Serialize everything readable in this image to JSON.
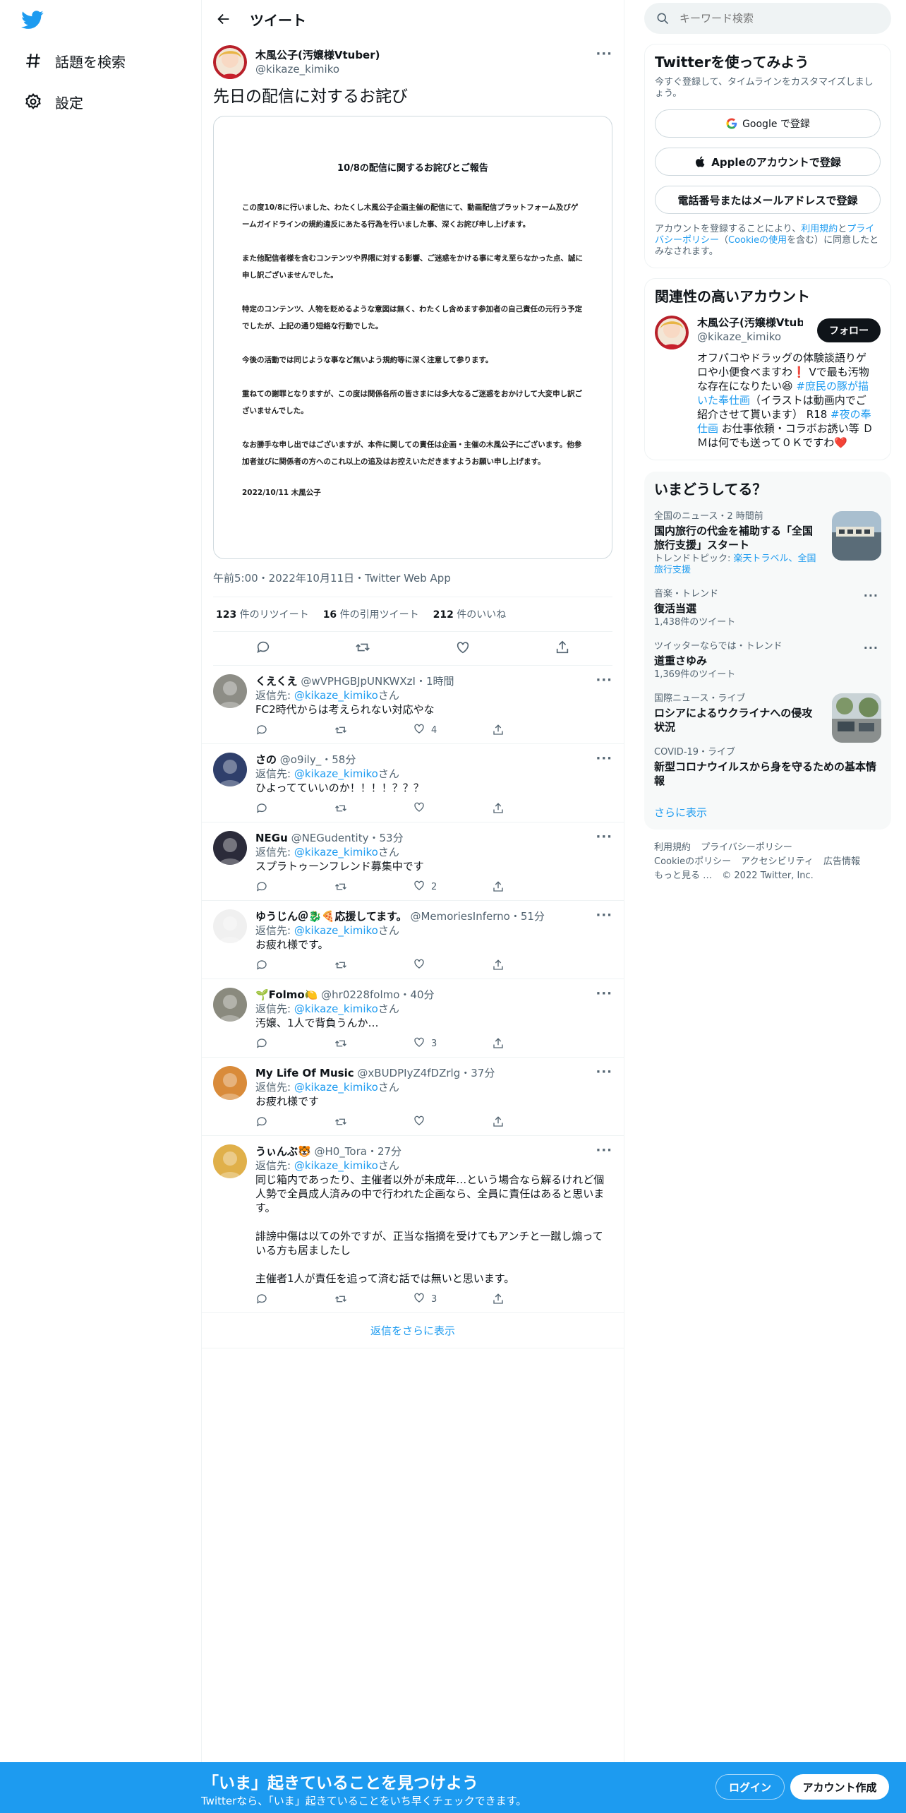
{
  "nav": {
    "explore_label": "話題を検索",
    "settings_label": "設定"
  },
  "header": {
    "title": "ツイート"
  },
  "tweet": {
    "author_name": "木風公子(汚嬢様Vtuber)",
    "author_handle": "@kikaze_kimiko",
    "text": "先日の配信に対するお詫び",
    "document": {
      "title": "10/8の配信に関するお詫びとご報告",
      "paragraphs": [
        "この度10/8に行いました、わたくし木風公子企画主催の配信にて、動画配信プラットフォーム及びゲームガイドラインの規約違反にあたる行為を行いました事、深くお詫び申し上げます。",
        "また他配信者様を含むコンテンツや界隈に対する影響、ご迷惑をかける事に考え至らなかった点、誠に申し訳ございませんでした。",
        "特定のコンテンツ、人物を貶めるような意図は無く、わたくし含めます参加者の自己責任の元行う予定でしたが、上記の通り短絡な行動でした。",
        "今後の活動では同じような事など無いよう規約等に深く注意して参ります。",
        "重ねての謝罪となりますが、この度は関係各所の皆さまには多大なるご迷惑をおかけして大変申し訳ございませんでした。",
        "なお勝手な申し出ではございますが、本件に関しての責任は企画・主催の木風公子にございます。他参加者並びに関係者の方へのこれ以上の追及はお控えいただきますようお願い申し上げます。"
      ],
      "signature": "2022/10/11 木風公子"
    },
    "meta": "午前5:00・2022年10月11日・Twitter Web App",
    "stats": {
      "retweets_num": "123",
      "retweets_label": " 件のリツイート",
      "quotes_num": "16",
      "quotes_label": " 件の引用ツイート",
      "likes_num": "212",
      "likes_label": " 件のいいね"
    }
  },
  "replies": [
    {
      "name": "くえくえ",
      "handle": "@wVPHGBJpUNKWXzI",
      "time": "・1時間",
      "to_prefix": "返信先: ",
      "to_handle": "@kikaze_kimiko",
      "to_suffix": "さん",
      "text": "FC2時代からは考えられない対応やな",
      "likes": "4"
    },
    {
      "name": "さの",
      "handle": "@o9ily_",
      "time": "・58分",
      "to_prefix": "返信先: ",
      "to_handle": "@kikaze_kimiko",
      "to_suffix": "さん",
      "text": "ひよってていいのか！！！！？？？",
      "likes": ""
    },
    {
      "name": "NEGu",
      "handle": "@NEGudentity",
      "time": "・53分",
      "to_prefix": "返信先: ",
      "to_handle": "@kikaze_kimiko",
      "to_suffix": "さん",
      "text": "スプラトゥーンフレンド募集中です",
      "likes": "2"
    },
    {
      "name": "ゆうじん＠🐉🍕応援してます。",
      "handle": "@MemoriesInferno",
      "time": "・51分",
      "to_prefix": "返信先: ",
      "to_handle": "@kikaze_kimiko",
      "to_suffix": "さん",
      "text": "お疲れ様です。",
      "likes": ""
    },
    {
      "name": "🌱Folmo🍋",
      "handle": "@hr0228folmo",
      "time": "・40分",
      "to_prefix": "返信先: ",
      "to_handle": "@kikaze_kimiko",
      "to_suffix": "さん",
      "text": "汚嬢、1人で背負うんか…",
      "likes": "3"
    },
    {
      "name": "My Life Of Music",
      "handle": "@xBUDPIyZ4fDZrlg",
      "time": "・37分",
      "to_prefix": "返信先: ",
      "to_handle": "@kikaze_kimiko",
      "to_suffix": "さん",
      "text": "お疲れ様です",
      "likes": ""
    },
    {
      "name": "うぃんぶ🐯",
      "handle": "@H0_Tora",
      "time": "・27分",
      "to_prefix": "返信先: ",
      "to_handle": "@kikaze_kimiko",
      "to_suffix": "さん",
      "text": "同じ箱内であったり、主催者以外が未成年…という場合なら解るけれど個人勢で全員成人済みの中で行われた企画なら、全員に責任はあると思います。\n\n誹謗中傷は以ての外ですが、正当な指摘を受けてもアンチと一蹴し煽っている方も居ましたし\n\n主催者1人が責任を追って済む話では無いと思います。",
      "likes": "3"
    }
  ],
  "show_more_replies": "返信をさらに表示",
  "search": {
    "placeholder": "キーワード検索"
  },
  "signup_card": {
    "title": "Twitterを使ってみよう",
    "subtitle": "今すぐ登録して、タイムラインをカスタマイズしましょう。",
    "google_label": "Google で登録",
    "apple_label": "Appleのアカウントで登録",
    "phone_label": "電話番号またはメールアドレスで登録",
    "legal_prefix": "アカウントを登録することにより、",
    "legal_terms": "利用規約",
    "legal_and": "と",
    "legal_privacy": "プライバシーポリシー",
    "legal_cookie_open": "（",
    "legal_cookie": "Cookieの使用",
    "legal_suffix": "を含む）に同意したとみなされます。"
  },
  "related": {
    "title": "関連性の高いアカウント",
    "name": "木風公子(汚嬢様Vtuber)",
    "handle": "@kikaze_kimiko",
    "follow_label": "フォロー",
    "bio_1": "オフパコやドラッグの体験談語りゲロや小便食べますわ❗ Vで最も汚物な存在になりたい😆 ",
    "bio_tag1": "#庶民の豚が描いた奉仕画",
    "bio_2": "（イラストは動画内でご紹介させて貰います） R18 ",
    "bio_tag2": "#夜の奉仕画",
    "bio_3": " お仕事依頼・コラボお誘い等 ＤＭは何でも送って０Ｋですわ❤️"
  },
  "trends": {
    "title": "いまどうしてる？",
    "items": [
      {
        "category": "全国のニュース・2 時間前",
        "name": "国内旅行の代金を補助する「全国旅行支援」スタート",
        "count_prefix": "トレンドトピック: ",
        "count_links": "楽天トラベル、全国旅行支援"
      },
      {
        "category": "音楽・トレンド",
        "name": "復活当選",
        "count": "1,438件のツイート"
      },
      {
        "category": "ツイッターならでは・トレンド",
        "name": "道重さゆみ",
        "count": "1,369件のツイート"
      },
      {
        "category": "国際ニュース・ライブ",
        "name": "ロシアによるウクライナへの侵攻状況"
      },
      {
        "category": "COVID-19・ライブ",
        "name": "新型コロナウイルスから身を守るための基本情報"
      }
    ],
    "show_more": "さらに表示"
  },
  "footer": {
    "links": [
      "利用規約",
      "プライバシーポリシー",
      "Cookieのポリシー",
      "アクセシビリティ",
      "広告情報",
      "もっと見る …"
    ],
    "copyright": "© 2022 Twitter, Inc."
  },
  "banner": {
    "headline": "「いま」起きていることを見つけよう",
    "sub": "Twitterなら、「いま」起きていることをいち早くチェックできます。",
    "login_label": "ログイン",
    "signup_label": "アカウント作成"
  },
  "colors": {
    "accent": "#1d9bf0",
    "text": "#0f1419",
    "muted": "#536471",
    "heart": "#f91880"
  }
}
